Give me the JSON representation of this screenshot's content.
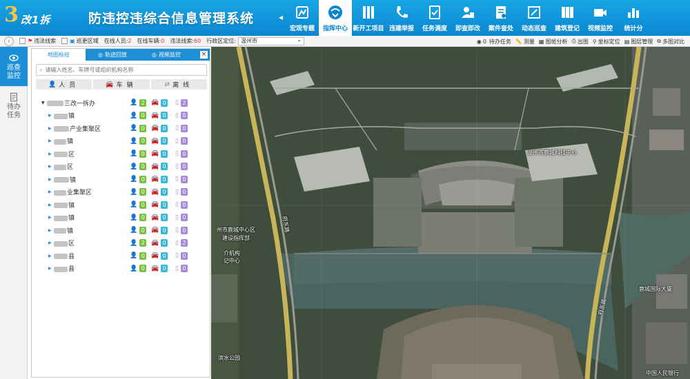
{
  "header": {
    "logo_number": "3",
    "logo_text": "改1拆",
    "title": "防违控违综合信息管理系统",
    "nav": [
      {
        "label": "宏观专题",
        "icon": "macro-topic-icon",
        "active": false
      },
      {
        "label": "指挥中心",
        "icon": "command-center-icon",
        "active": true
      },
      {
        "label": "新开工项目",
        "icon": "new-project-icon",
        "active": false
      },
      {
        "label": "违建举报",
        "icon": "report-phone-icon",
        "active": false
      },
      {
        "label": "任务调度",
        "icon": "task-dispatch-icon",
        "active": false
      },
      {
        "label": "即查即改",
        "icon": "check-fix-icon",
        "active": false
      },
      {
        "label": "案件查处",
        "icon": "case-icon",
        "active": false
      },
      {
        "label": "动态巡查",
        "icon": "patrol-icon",
        "active": false
      },
      {
        "label": "建筑登记",
        "icon": "building-register-icon",
        "active": false
      },
      {
        "label": "视频监控",
        "icon": "video-camera-icon",
        "active": false
      },
      {
        "label": "统计分",
        "icon": "statistics-icon",
        "active": false
      }
    ]
  },
  "toolbar": {
    "violation_clues": "违法线索",
    "patrol_area": "巡更区域",
    "online_people_label": "在线人员:",
    "online_people": "2",
    "online_vehicles_label": "在线车辆:",
    "online_vehicles": "0",
    "violation_clues_count_label": "违法线索:",
    "violation_clues_count": "60",
    "region_label": "行政区定位:",
    "region_value": "温州市",
    "todo_tasks_count": "0",
    "todo_tasks": "待办任务",
    "measure": "测量",
    "layer_analysis": "图斑分析",
    "print_map": "出图",
    "coord_locate": "坐标定位",
    "layer_manage": "图层管理",
    "multi_compare": "多图对比"
  },
  "sidebar": {
    "tabs": [
      {
        "label_1": "巡查",
        "label_2": "监控",
        "active": true
      },
      {
        "label_1": "待办",
        "label_2": "任务",
        "active": false
      }
    ]
  },
  "panel": {
    "tabs": [
      "地图标绘",
      "轨迹回放",
      "视频监控"
    ],
    "close": "×",
    "search_placeholder": "请输入姓名、车牌号或组织机构名称",
    "filters": [
      "人员",
      "车辆",
      "离线"
    ],
    "tree": [
      {
        "name": "三改一拆办",
        "people": "2",
        "cars": "0",
        "devices": "2",
        "root": true
      },
      {
        "name": "镇",
        "people": "0",
        "cars": "0",
        "devices": "0"
      },
      {
        "name": "产业集聚区",
        "people": "0",
        "cars": "0",
        "devices": "0"
      },
      {
        "name": "镇",
        "people": "0",
        "cars": "0",
        "devices": "0"
      },
      {
        "name": "区",
        "people": "0",
        "cars": "0",
        "devices": "0"
      },
      {
        "name": "区",
        "people": "0",
        "cars": "0",
        "devices": "0"
      },
      {
        "name": "镇",
        "people": "0",
        "cars": "0",
        "devices": "0"
      },
      {
        "name": "业集聚区",
        "people": "0",
        "cars": "0",
        "devices": "0"
      },
      {
        "name": "镇",
        "people": "0",
        "cars": "0",
        "devices": "0"
      },
      {
        "name": "镇",
        "people": "0",
        "cars": "0",
        "devices": "0"
      },
      {
        "name": "镇",
        "people": "0",
        "cars": "0",
        "devices": "0"
      },
      {
        "name": "区",
        "people": "2",
        "cars": "0",
        "devices": "2"
      },
      {
        "name": "县",
        "people": "0",
        "cars": "0",
        "devices": "0"
      },
      {
        "name": "县",
        "people": "0",
        "cars": "0",
        "devices": "0"
      }
    ]
  },
  "map": {
    "labels": {
      "district_center": "州市鹿城中心区",
      "building_office": "建设指挥部",
      "media_center": "介机构",
      "registry_center": "记中心",
      "road_left": "府东路",
      "road_right": "府东路",
      "tech_building": "温州市鹿城科技中心",
      "finance_building": "鹿城国际大厦",
      "park": "滨水公园",
      "bank": "中国人民银行"
    }
  }
}
